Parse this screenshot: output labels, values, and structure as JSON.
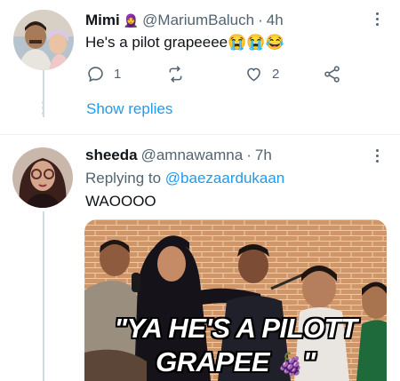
{
  "tweet1": {
    "name": "Mimi",
    "name_emoji": "🧕",
    "handle": "@MariumBaluch",
    "separator": "·",
    "time": "4h",
    "text": "He's a pilot grapeeee",
    "text_emojis": "😭😭😂",
    "reply_count": "1",
    "like_count": "2",
    "show_replies": "Show replies"
  },
  "tweet2": {
    "name": "sheeda",
    "handle": "@amnawamna",
    "separator": "·",
    "time": "7h",
    "replying_to_prefix": "Replying to",
    "replying_to_handle": "@baezaardukaan",
    "text": "WAOOOO",
    "media_caption_line1": "\"YA HE'S A PILOTT",
    "media_caption_line2": "GRAPEE",
    "media_caption_emoji": "🍇",
    "media_caption_end": "\""
  },
  "icons": [
    "reply-icon",
    "retweet-icon",
    "like-icon",
    "share-icon",
    "more-icon"
  ],
  "colors": {
    "accent": "#1d9bf0",
    "secondary_text": "#536471",
    "divider": "#eff3f4"
  }
}
